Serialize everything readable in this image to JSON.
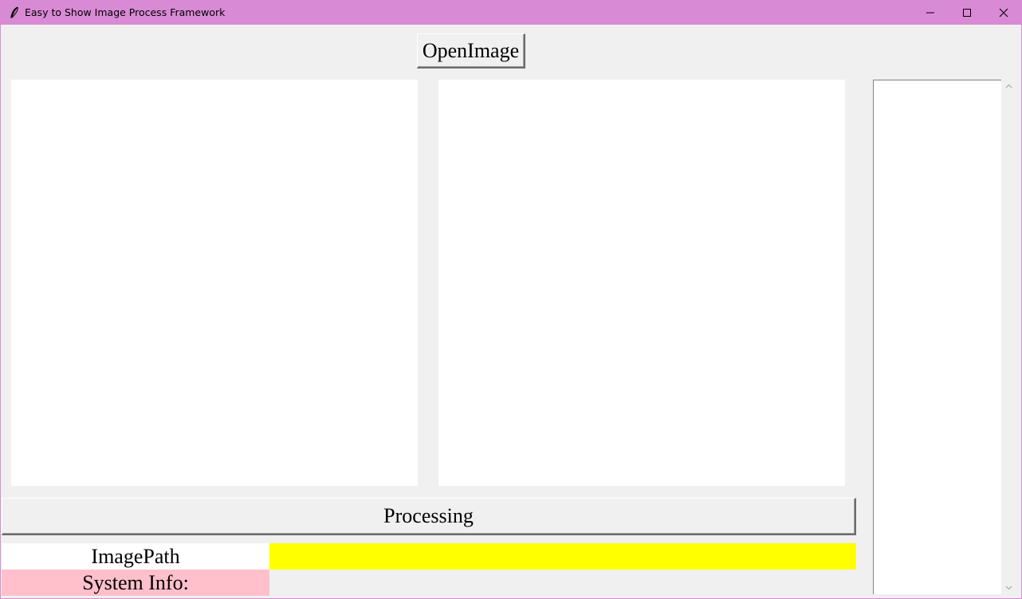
{
  "window": {
    "title": "Easy to Show Image Process Framework",
    "titlebar_color": "#d98ad4",
    "icon": "feather-icon",
    "controls": [
      "minimize-icon",
      "maximize-icon",
      "close-icon"
    ]
  },
  "toolbar": {
    "open_label": "OpenImage"
  },
  "canvases": {
    "left": "original-image-canvas",
    "right": "processed-image-canvas"
  },
  "listbox": {
    "items": []
  },
  "actions": {
    "process_label": "Processing"
  },
  "info": {
    "path_label": "ImagePath",
    "path_value": "",
    "path_bg": "#ffff00",
    "sysinfo_label": "System Info:",
    "sysinfo_bg": "#ffc0cb",
    "sysinfo_value": ""
  }
}
